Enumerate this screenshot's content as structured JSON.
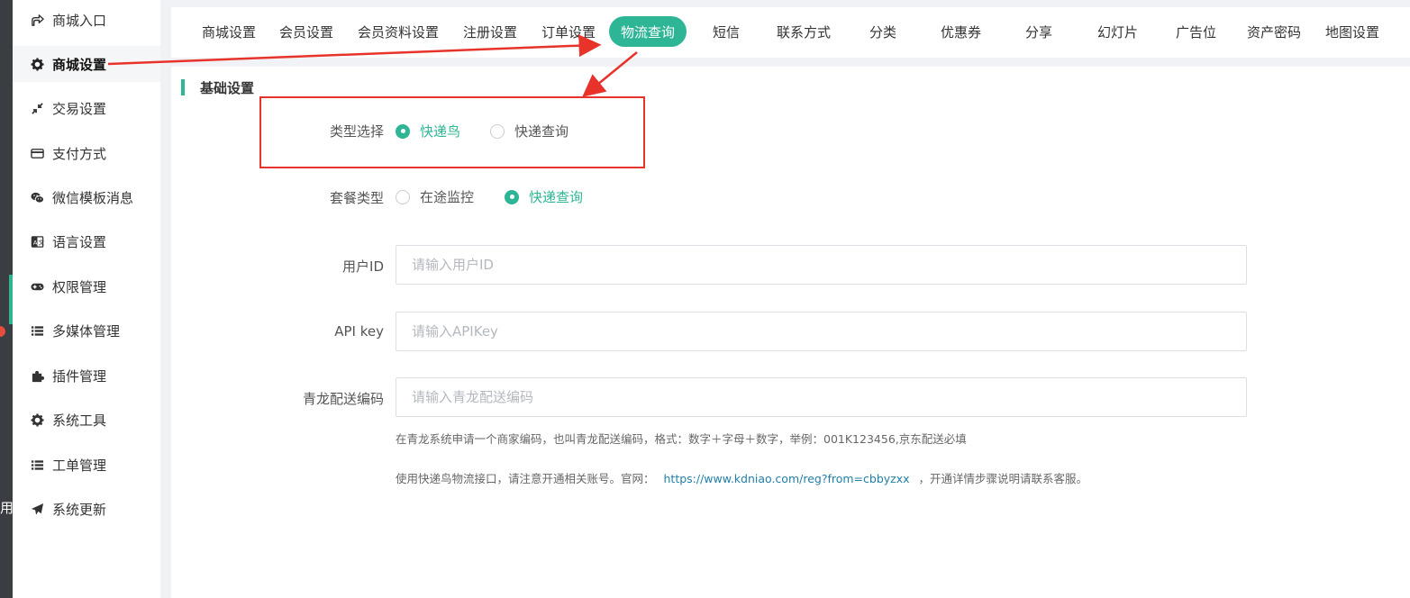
{
  "sidebar": {
    "items": [
      {
        "label": "商城入口",
        "icon": "share-icon"
      },
      {
        "label": "商城设置",
        "icon": "gear-icon",
        "active": true
      },
      {
        "label": "交易设置",
        "icon": "compress-icon"
      },
      {
        "label": "支付方式",
        "icon": "credit-card-icon"
      },
      {
        "label": "微信模板消息",
        "icon": "wechat-icon"
      },
      {
        "label": "语言设置",
        "icon": "language-icon"
      },
      {
        "label": "权限管理",
        "icon": "gamepad-icon"
      },
      {
        "label": "多媒体管理",
        "icon": "list-icon"
      },
      {
        "label": "插件管理",
        "icon": "puzzle-icon"
      },
      {
        "label": "系统工具",
        "icon": "gear-icon"
      },
      {
        "label": "工单管理",
        "icon": "list-icon"
      },
      {
        "label": "系统更新",
        "icon": "paper-plane-icon"
      }
    ],
    "edge_char": "用"
  },
  "tabs": [
    {
      "label": "商城设置"
    },
    {
      "label": "会员设置"
    },
    {
      "label": "会员资料设置"
    },
    {
      "label": "注册设置"
    },
    {
      "label": "订单设置"
    },
    {
      "label": "物流查询",
      "active": true
    },
    {
      "label": "短信"
    },
    {
      "label": "联系方式"
    },
    {
      "label": "分类"
    },
    {
      "label": "优惠券"
    },
    {
      "label": "分享"
    },
    {
      "label": "幻灯片"
    },
    {
      "label": "广告位"
    },
    {
      "label": "资产密码"
    },
    {
      "label": "地图设置"
    }
  ],
  "section": {
    "title": "基础设置"
  },
  "form": {
    "type_select": {
      "label": "类型选择",
      "options": [
        {
          "label": "快递鸟",
          "checked": true
        },
        {
          "label": "快递查询",
          "checked": false
        }
      ]
    },
    "package_type": {
      "label": "套餐类型",
      "options": [
        {
          "label": "在途监控",
          "checked": false
        },
        {
          "label": "快递查询",
          "checked": true
        }
      ]
    },
    "user_id": {
      "label": "用户ID",
      "value": "",
      "placeholder": "请输入用户ID"
    },
    "api_key": {
      "label": "API key",
      "value": "",
      "placeholder": "请输入APIKey"
    },
    "qinglong_code": {
      "label": "青龙配送编码",
      "value": "",
      "placeholder": "请输入青龙配送编码"
    },
    "help_qinglong": "在青龙系统申请一个商家编码，也叫青龙配送编码，格式：数字＋字母＋数字，举例：001K123456,京东配送必填",
    "help_kdniao": {
      "before": "使用快递鸟物流接口，请注意开通相关账号。官网：",
      "link": "https://www.kdniao.com/reg?from=cbbyzxx",
      "after": "，开通详情步骤说明请联系客服。"
    }
  },
  "colors": {
    "accent": "#2db596",
    "annotation": "#e8332b",
    "link": "#1f7fa8"
  }
}
